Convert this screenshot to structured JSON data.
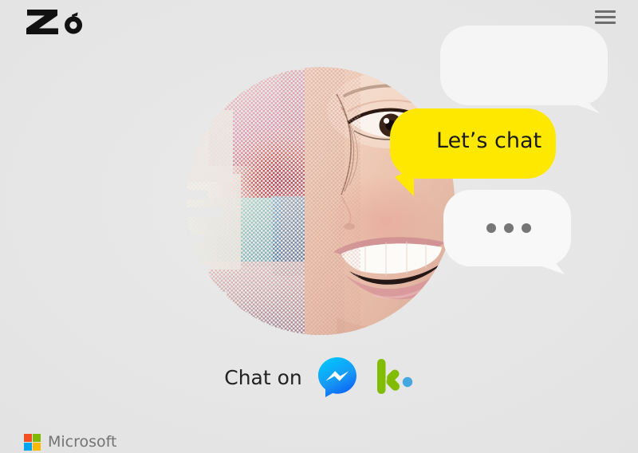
{
  "page": {
    "background_color": "#e4e4e4",
    "title": "Zo"
  },
  "header": {
    "logo_text": "Zo",
    "logo_name": "zo-logo",
    "menu_icon": "hamburger-menu-icon"
  },
  "hero": {
    "alt": "Glitched halftone portrait of a smiling woman",
    "shape": "circle",
    "effect": "halftone-glitch"
  },
  "bubbles": [
    {
      "id": "top",
      "text": "",
      "color": "#f5f5f5",
      "tail": "bottom-right"
    },
    {
      "id": "yellow",
      "text": "Let’s chat",
      "color": "#ffe800",
      "text_color": "#1a1a1a",
      "tail": "bottom-left"
    },
    {
      "id": "dots",
      "text": "",
      "color": "#f7f7f7",
      "tail": "bottom-right",
      "dots": 3,
      "dot_color": "#767676"
    }
  ],
  "chat_row": {
    "label": "Chat on",
    "services": [
      {
        "name": "messenger",
        "icon": "facebook-messenger-icon",
        "colors": [
          "#00B2FF",
          "#006AFF"
        ]
      },
      {
        "name": "kik",
        "icon": "kik-icon",
        "colors": [
          "#82BC00",
          "#45A7E0"
        ]
      }
    ]
  },
  "footer": {
    "brand": "Microsoft",
    "logo_name": "microsoft-logo",
    "tile_colors": [
      "#f25022",
      "#7fba00",
      "#00a4ef",
      "#ffb900"
    ],
    "text_color": "#737373"
  }
}
